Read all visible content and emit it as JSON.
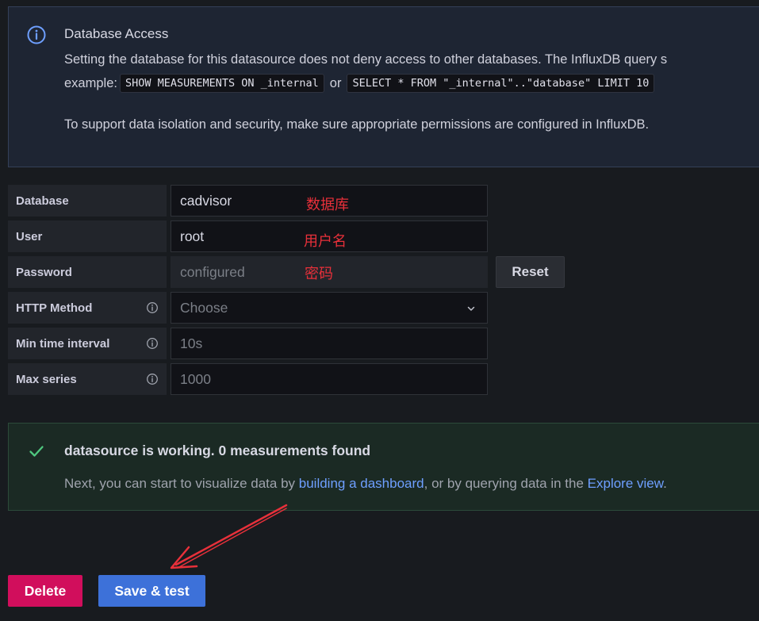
{
  "info_alert": {
    "title": "Database Access",
    "line1": "Setting the database for this datasource does not deny access to other databases. The InfluxDB query s",
    "line2_prefix": "example:",
    "code1": "SHOW MEASUREMENTS ON _internal",
    "connector": "or",
    "code2": "SELECT * FROM \"_internal\"..\"database\" LIMIT 10",
    "line3": "To support data isolation and security, make sure appropriate permissions are configured in InfluxDB.",
    "icon": "info-circle-icon"
  },
  "form": {
    "database": {
      "label": "Database",
      "value": "cadvisor",
      "annotation": "数据库"
    },
    "user": {
      "label": "User",
      "value": "root",
      "annotation": "用户名"
    },
    "password": {
      "label": "Password",
      "value": "configured",
      "annotation": "密码",
      "reset_label": "Reset"
    },
    "http_method": {
      "label": "HTTP Method",
      "placeholder": "Choose"
    },
    "min_time_interval": {
      "label": "Min time interval",
      "placeholder": "10s"
    },
    "max_series": {
      "label": "Max series",
      "placeholder": "1000"
    }
  },
  "success_alert": {
    "title": "datasource is working. 0 measurements found",
    "body_prefix": "Next, you can start to visualize data by ",
    "link1": "building a dashboard",
    "body_middle": ", or by querying data in the ",
    "link2": "Explore view",
    "body_suffix": ".",
    "icon": "check-icon"
  },
  "buttons": {
    "delete": "Delete",
    "save_test": "Save & test"
  },
  "colors": {
    "background": "#181b1f",
    "info_bg": "#1e2533",
    "success_bg": "#1b2a24",
    "delete": "#d10e5c",
    "primary": "#3d71d9",
    "link": "#6e9fff",
    "annotation": "#e8303a"
  }
}
